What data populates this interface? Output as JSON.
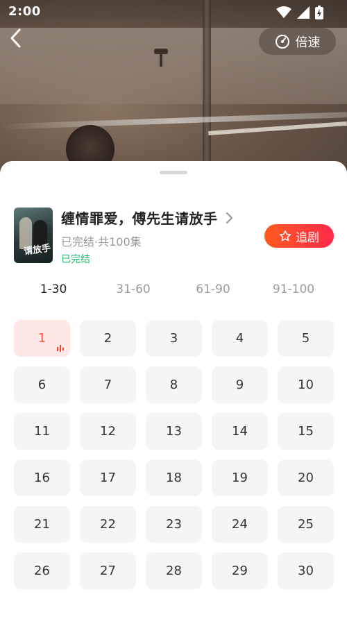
{
  "status_bar": {
    "time": "2:00"
  },
  "player": {
    "speed_label": "倍速"
  },
  "drama": {
    "title": "缠情罪爱，傅先生请放手",
    "meta": "已完结·共100集",
    "status": "已完结",
    "poster_title": "请放手",
    "follow_label": "追剧"
  },
  "tabs": [
    "1-30",
    "31-60",
    "61-90",
    "91-100"
  ],
  "active_tab": 0,
  "episodes": [
    "1",
    "2",
    "3",
    "4",
    "5",
    "6",
    "7",
    "8",
    "9",
    "10",
    "11",
    "12",
    "13",
    "14",
    "15",
    "16",
    "17",
    "18",
    "19",
    "20",
    "21",
    "22",
    "23",
    "24",
    "25",
    "26",
    "27",
    "28",
    "29",
    "30"
  ],
  "current_episode": 1,
  "colors": {
    "accent": "#ff3d2e",
    "active_bg": "#fde7e7",
    "complete_green": "#1db46a"
  }
}
